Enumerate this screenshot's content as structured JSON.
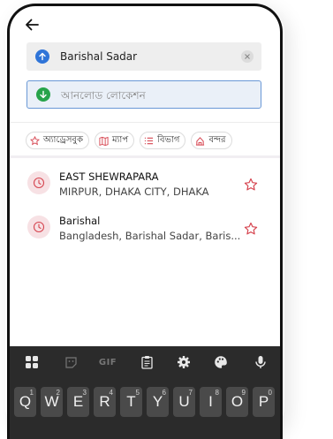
{
  "search": {
    "from_value": "Barishal Sadar",
    "to_placeholder": "আনলোড লোকেশন"
  },
  "chips": [
    {
      "label": "অ্যাড্রেসবুক",
      "icon": "star-icon"
    },
    {
      "label": "ম্যাপ",
      "icon": "map-icon"
    },
    {
      "label": "বিভাগ",
      "icon": "list-icon"
    },
    {
      "label": "বন্দর",
      "icon": "port-icon"
    }
  ],
  "recent": [
    {
      "title": "EAST SHEWRAPARA",
      "subtitle": "MIRPUR, DHAKA CITY, DHAKA"
    },
    {
      "title": "Barishal",
      "subtitle": "Bangladesh, Barishal Sadar, Baris..."
    }
  ],
  "keyboard": {
    "toolbar": [
      "apps-icon",
      "sticker-icon",
      "GIF",
      "clipboard-icon",
      "settings-icon",
      "palette-icon",
      "mic-icon"
    ],
    "gif_label": "GIF",
    "keys": [
      {
        "k": "Q",
        "n": "1"
      },
      {
        "k": "W",
        "n": "2"
      },
      {
        "k": "E",
        "n": "3"
      },
      {
        "k": "R",
        "n": "4"
      },
      {
        "k": "T",
        "n": "5"
      },
      {
        "k": "Y",
        "n": "6"
      },
      {
        "k": "U",
        "n": "7"
      },
      {
        "k": "I",
        "n": "8"
      },
      {
        "k": "O",
        "n": "9"
      },
      {
        "k": "P",
        "n": "0"
      }
    ]
  },
  "colors": {
    "accent_blue": "#2f74d8",
    "accent_green": "#27a34a",
    "accent_red": "#d64550",
    "keyboard_bg": "#2b2b2b"
  }
}
